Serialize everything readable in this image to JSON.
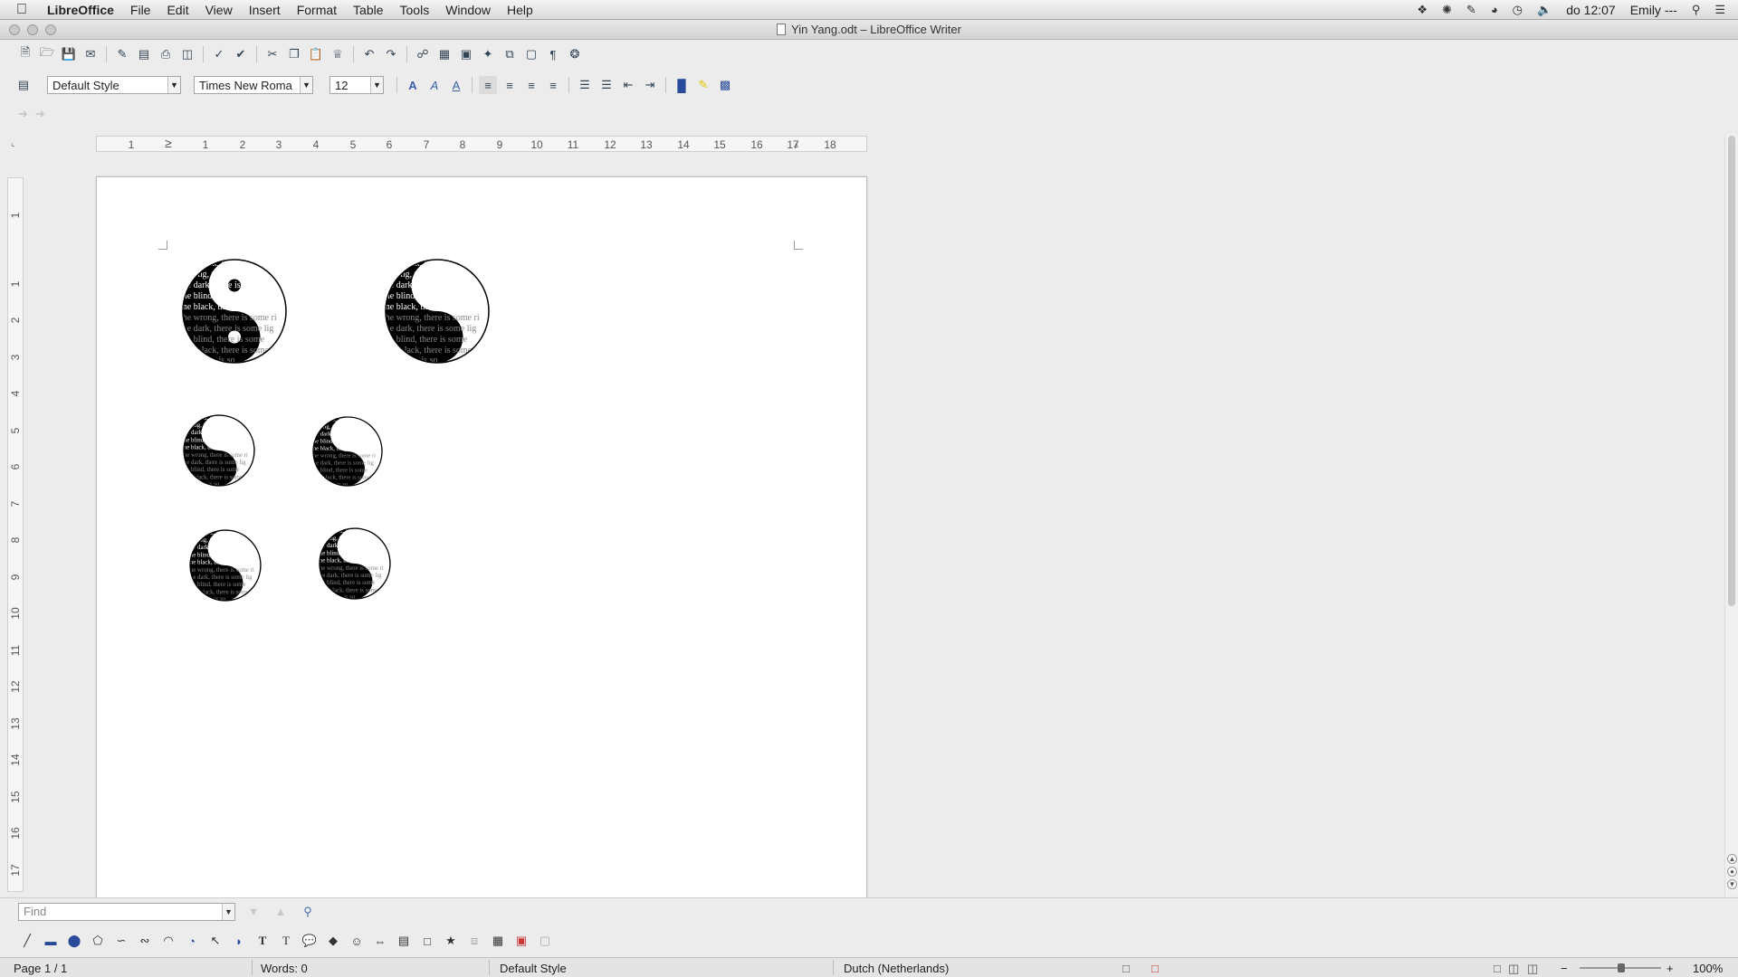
{
  "menubar": {
    "app_name": "LibreOffice",
    "menus": [
      "File",
      "Edit",
      "View",
      "Insert",
      "Format",
      "Table",
      "Tools",
      "Window",
      "Help"
    ],
    "clock": "do 12:07",
    "user": "Emily ---"
  },
  "window": {
    "title": "Yin Yang.odt – LibreOffice Writer"
  },
  "formatting": {
    "paragraph_style": "Default Style",
    "font_name": "Times New Roma",
    "font_size": "12"
  },
  "ruler": {
    "horizontal_ticks": [
      "1",
      "1",
      "2",
      "3",
      "4",
      "5",
      "6",
      "7",
      "8",
      "9",
      "10",
      "11",
      "12",
      "13",
      "14",
      "15",
      "16",
      "17",
      "18"
    ],
    "vertical_ticks": [
      "1",
      "1",
      "2",
      "3",
      "4",
      "5",
      "6",
      "7",
      "8",
      "9",
      "10",
      "11",
      "12",
      "13",
      "14",
      "15",
      "16",
      "17"
    ]
  },
  "yin_yang_text": [
    "the dark, there is",
    "wrong, there is some",
    "the dark, there is some",
    "the blind, there is some sig",
    "the black, there is some wh",
    "the wrong, there is some ri",
    "the dark, there is some lig",
    "the blind, there is some",
    "the black, there is some",
    "there is so"
  ],
  "find": {
    "placeholder": "Find"
  },
  "status": {
    "page": "Page 1 / 1",
    "words": "Words: 0",
    "style": "Default Style",
    "language": "Dutch (Netherlands)",
    "zoom": "100%"
  }
}
